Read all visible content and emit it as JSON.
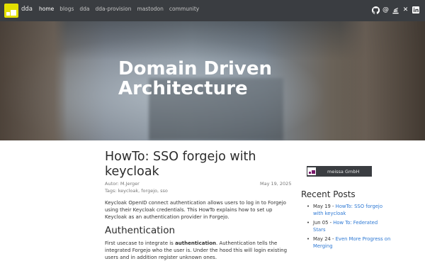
{
  "nav": {
    "brand": "dda",
    "links": [
      "home",
      "blogs",
      "dda",
      "dda-provision",
      "mastodon",
      "community"
    ],
    "social_icons": [
      "github-icon",
      "mastodon-icon",
      "stack-icon",
      "xing-icon",
      "linkedin-icon"
    ]
  },
  "hero": {
    "title_line1": "Domain Driven",
    "title_line2": "Architecture"
  },
  "post": {
    "title": "HowTo: SSO forgejo with keycloak",
    "author": "Autor: M.Jerger",
    "date": "May 19, 2025",
    "tags": "Tags: keycloak, forgejo, sso",
    "intro": "Keycloak OpenID connect authentication allows users to log in to Forgejo using their Keycloak credentials. This HowTo explains how to set up Keycloak as an authentication provider in Forgejo.",
    "section_heading": "Authentication",
    "section_text_before": "First usecase to integrate is ",
    "section_text_bold": "authentication",
    "section_text_after": ". Authentication tells the integrated Forgejo who the user is. Under the hood this will login existing users and in addition register unknown ones."
  },
  "sidebar": {
    "sponsor": "meissa GmbH",
    "recent_title": "Recent Posts",
    "recent_posts": [
      {
        "date": "May 19 - ",
        "title": "HowTo: SSO forgejo with keycloak"
      },
      {
        "date": "Jun 05 - ",
        "title": "How To: Federated Stars"
      },
      {
        "date": "May 24 - ",
        "title": "Even More Progress on Merging"
      }
    ]
  },
  "colors": {
    "navbar": "#3a3d41",
    "logo": "#e3e000",
    "link": "#2e79d4",
    "sponsor_accent": "#7a1b6b"
  }
}
